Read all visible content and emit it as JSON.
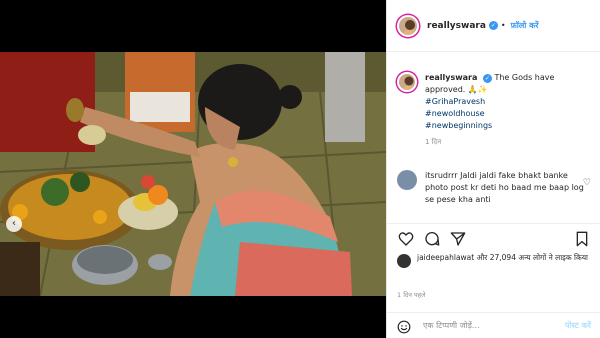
{
  "post": {
    "username": "reallyswara",
    "follow_label": "फ़ॉलो करें",
    "caption_lead": "The Gods have approved. 🙏✨",
    "hashtags": [
      "#GrihaPravesh",
      "#newoldhouse",
      "#newbeginnings"
    ],
    "caption_time": "1 दिन"
  },
  "comment": {
    "text": "itsrudrrr Jaldi jaldi fake bhakt banke photo post kr deti ho baad me baap log se pese kha anti"
  },
  "likes": {
    "text": "jaideepahlawat और 27,094 अन्य लोगों ने लाइक किया"
  },
  "posted_time": "1 दिन पहले",
  "add_comment": {
    "placeholder": "एक टिप्पणी जोड़ें...",
    "post_label": "पोस्ट करें"
  },
  "icons": {
    "like": "heart-icon",
    "comment": "comment-icon",
    "share": "share-icon",
    "save": "bookmark-icon",
    "emoji": "emoji-icon",
    "prev": "chevron-left-icon"
  },
  "colors": {
    "link": "#3897f0",
    "hashtag": "#00376b",
    "muted": "#8e8e8e"
  }
}
